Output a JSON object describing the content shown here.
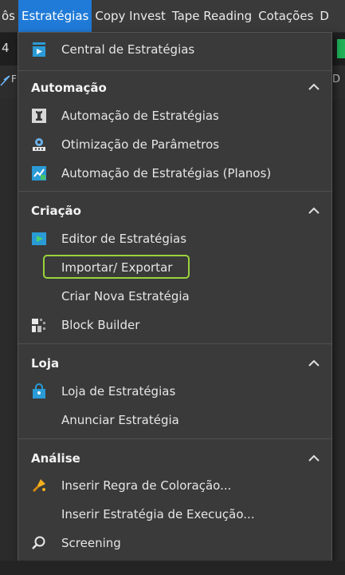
{
  "menubar": {
    "items": [
      {
        "label": "ôs"
      },
      {
        "label": "Estratégias"
      },
      {
        "label": "Copy Invest"
      },
      {
        "label": "Tape Reading"
      },
      {
        "label": "Cotações"
      },
      {
        "label": "D"
      }
    ],
    "active_color": "#1f7ad8"
  },
  "background": {
    "left_number": "4",
    "left_letter": "F",
    "right_letter": "D"
  },
  "dropdown": {
    "central": {
      "label": "Central de Estratégias",
      "icon": "strategy-center-icon"
    },
    "sections": [
      {
        "title": "Automação",
        "items": [
          {
            "label": "Automação de Estratégias",
            "icon": "robot-icon"
          },
          {
            "label": "Otimização de Parâmetros",
            "icon": "optimization-icon"
          },
          {
            "label": "Automação de Estratégias (Planos)",
            "icon": "automation-plans-icon"
          }
        ]
      },
      {
        "title": "Criação",
        "items": [
          {
            "label": "Editor de Estratégias",
            "icon": "editor-icon"
          },
          {
            "label": "Importar/ Exportar",
            "icon": ""
          },
          {
            "label": "Criar Nova Estratégia",
            "icon": ""
          },
          {
            "label": "Block Builder",
            "icon": "block-builder-icon"
          }
        ]
      },
      {
        "title": "Loja",
        "items": [
          {
            "label": "Loja de Estratégias",
            "icon": "shopping-bag-icon"
          },
          {
            "label": "Anunciar Estratégia",
            "icon": ""
          }
        ]
      },
      {
        "title": "Análise",
        "items": [
          {
            "label": "Inserir Regra de Coloração...",
            "icon": "paint-icon"
          },
          {
            "label": "Inserir Estratégia de Execução...",
            "icon": ""
          },
          {
            "label": "Screening",
            "icon": "search-icon"
          }
        ]
      }
    ],
    "highlight_color": "#9ad33c"
  }
}
